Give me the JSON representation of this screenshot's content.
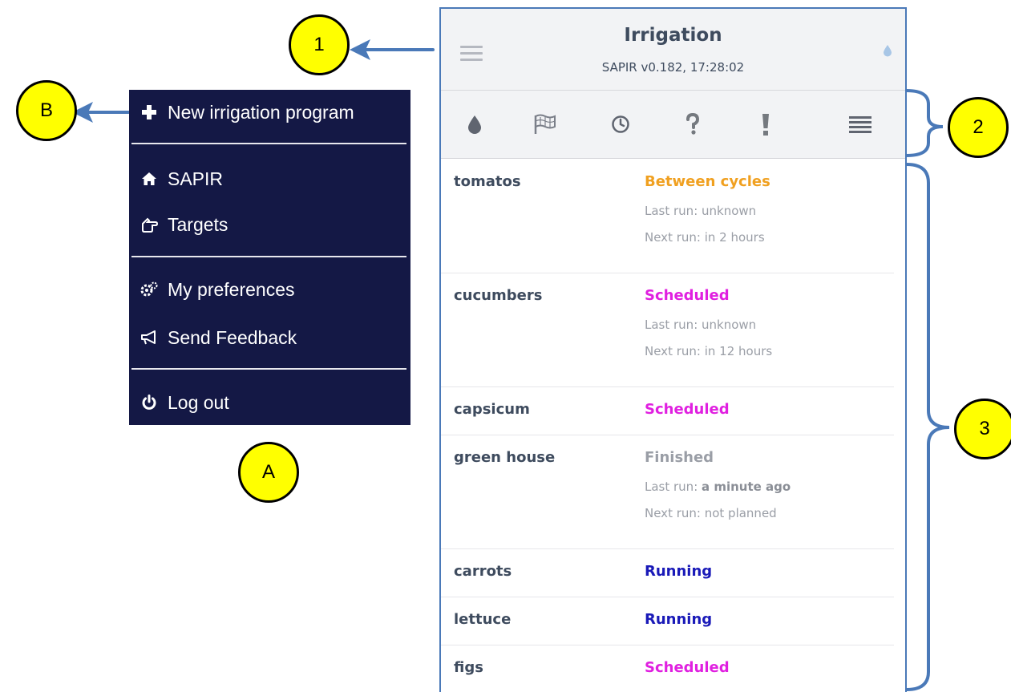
{
  "callouts": {
    "one": "1",
    "two": "2",
    "three": "3",
    "a": "A",
    "b": "B",
    "fill_color": "#ffff00",
    "arrow_color": "#4a79b8"
  },
  "menu": {
    "background": "#141845",
    "items": [
      {
        "label": "New irrigation program",
        "icon": "plus-icon"
      },
      {
        "label": "SAPIR",
        "icon": "home-icon"
      },
      {
        "label": "Targets",
        "icon": "hand-pointer-icon"
      },
      {
        "label": "My preferences",
        "icon": "gears-icon"
      },
      {
        "label": "Send Feedback",
        "icon": "megaphone-icon"
      },
      {
        "label": "Log out",
        "icon": "power-icon"
      }
    ]
  },
  "app": {
    "title": "Irrigation",
    "subtitle": "SAPIR v0.182, 17:28:02",
    "toolbar": [
      "drop-icon",
      "flag-icon",
      "clock-icon",
      "question-icon",
      "exclamation-icon",
      "list-icon"
    ]
  },
  "programs": [
    {
      "name": "tomatos",
      "status": "Between cycles",
      "status_color": "#f0a020",
      "last_prefix": "Last run: ",
      "last_value": "unknown",
      "next": "Next run: in 2 hours"
    },
    {
      "name": "cucumbers",
      "status": "Scheduled",
      "status_color": "#e020e0",
      "last_prefix": "Last run: ",
      "last_value": "unknown",
      "next": "Next run: in 12 hours"
    },
    {
      "name": "capsicum",
      "status": "Scheduled",
      "status_color": "#e020e0"
    },
    {
      "name": "green house",
      "status": "Finished",
      "status_color": "#9a9ea6",
      "last_prefix": "Last run: ",
      "last_value": "a minute ago",
      "next": "Next run: not planned"
    },
    {
      "name": "carrots",
      "status": "Running",
      "status_color": "#1a1ab8"
    },
    {
      "name": "lettuce",
      "status": "Running",
      "status_color": "#1a1ab8"
    },
    {
      "name": "figs",
      "status": "Scheduled",
      "status_color": "#e020e0"
    }
  ]
}
